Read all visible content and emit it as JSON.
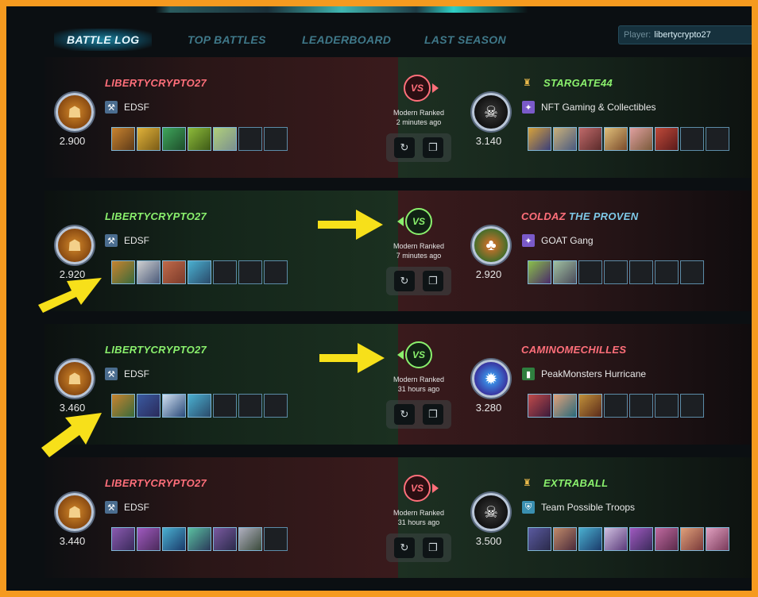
{
  "tabs": [
    "BATTLE LOG",
    "TOP BATTLES",
    "LEADERBOARD",
    "LAST SEASON"
  ],
  "player_filter": {
    "label": "Player:",
    "value": "libertycrypto27"
  },
  "icons": {
    "replay": "replay-icon",
    "copy": "copy-icon",
    "guild": "guild-banner-icon"
  },
  "colors": {
    "loss": "#ff6f7a",
    "win": "#8af06d",
    "frame": "#f59a1f",
    "guild_alt": "#7ec9e8"
  },
  "battles": [
    {
      "result": "loss",
      "player": {
        "name": "LIBERTYCRYPTO27",
        "guild": "EDSF",
        "rating": "2.900"
      },
      "vs": "VS",
      "mode": "Modern Ranked",
      "time": "2 minutes ago",
      "opponent": {
        "name": "STARGATE44",
        "name_suffix": "",
        "guild": "NFT Gaming & Collectibles",
        "rating": "3.140"
      }
    },
    {
      "result": "win",
      "player": {
        "name": "LIBERTYCRYPTO27",
        "guild": "EDSF",
        "rating": "2.920"
      },
      "vs": "VS",
      "mode": "Modern Ranked",
      "time": "7 minutes ago",
      "opponent": {
        "name": "COLDAZ",
        "name_suffix": "THE PROVEN",
        "guild": "GOAT Gang",
        "rating": "2.920"
      }
    },
    {
      "result": "win",
      "player": {
        "name": "LIBERTYCRYPTO27",
        "guild": "EDSF",
        "rating": "3.460"
      },
      "vs": "VS",
      "mode": "Modern Ranked",
      "time": "31 hours ago",
      "opponent": {
        "name": "CAMINOMECHILLES",
        "name_suffix": "",
        "guild": "PeakMonsters Hurricane",
        "rating": "3.280"
      }
    },
    {
      "result": "loss",
      "player": {
        "name": "LIBERTYCRYPTO27",
        "guild": "EDSF",
        "rating": "3.440"
      },
      "vs": "VS",
      "mode": "Modern Ranked",
      "time": "31 hours ago",
      "opponent": {
        "name": "EXTRABALL",
        "name_suffix": "",
        "guild": "Team Possible Troops",
        "rating": "3.500"
      }
    }
  ]
}
